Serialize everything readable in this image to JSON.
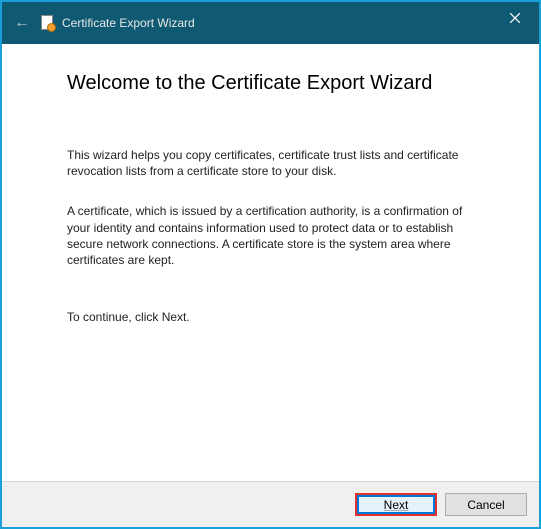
{
  "titlebar": {
    "title": "Certificate Export Wizard"
  },
  "content": {
    "heading": "Welcome to the Certificate Export Wizard",
    "paragraph1": "This wizard helps you copy certificates, certificate trust lists and certificate revocation lists from a certificate store to your disk.",
    "paragraph2": "A certificate, which is issued by a certification authority, is a confirmation of your identity and contains information used to protect data or to establish secure network connections. A certificate store is the system area where certificates are kept.",
    "continue": "To continue, click Next."
  },
  "footer": {
    "next": "Next",
    "cancel": "Cancel"
  }
}
